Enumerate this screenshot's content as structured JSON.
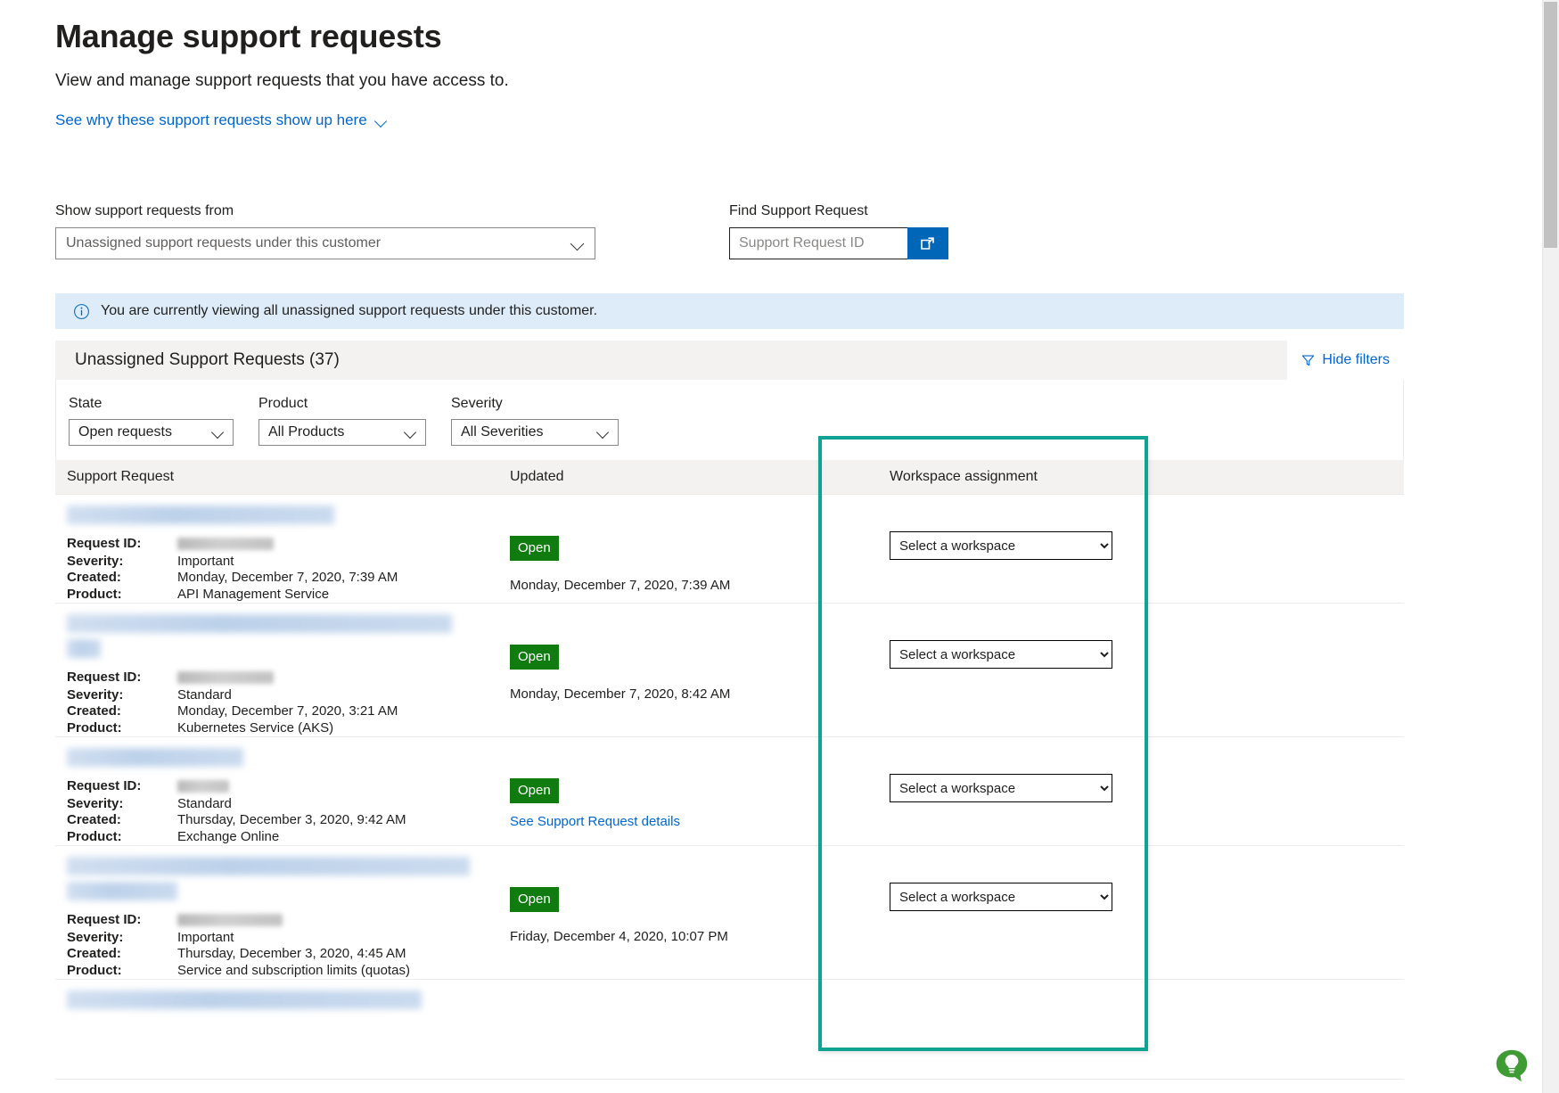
{
  "header": {
    "title": "Manage support requests",
    "subtitle": "View and manage support requests that you have access to.",
    "why_link": "See why these support requests show up here"
  },
  "top_filters": {
    "show_label": "Show support requests from",
    "show_value": "Unassigned support requests under this customer",
    "find_label": "Find Support Request",
    "find_placeholder": "Support Request ID",
    "find_value": "",
    "search_icon": "open-in-new-window-icon",
    "search_button_color": "#0067b8"
  },
  "info_banner": {
    "icon": "info-icon",
    "text": "You are currently viewing all unassigned support requests under this customer.",
    "background": "#deecf9"
  },
  "panel": {
    "title": "Unassigned Support Requests (37)",
    "hide_filters_label": "Hide filters",
    "hide_filters_icon": "funnel-icon",
    "filters": [
      {
        "label": "State",
        "value": "Open requests"
      },
      {
        "label": "Product",
        "value": "All Products"
      },
      {
        "label": "Severity",
        "value": "All Severities"
      }
    ],
    "columns": {
      "request": "Support Request",
      "updated": "Updated",
      "workspace": "Workspace assignment"
    },
    "labels": {
      "request_id": "Request ID:",
      "severity": "Severity:",
      "created": "Created:",
      "product": "Product:"
    },
    "workspace_placeholder": "Select a workspace",
    "workspace_options": [
      "Select a workspace"
    ],
    "rows": [
      {
        "title_redacted": true,
        "title_lines": [
          300
        ],
        "request_id_redacted": true,
        "request_id_width": 108,
        "severity": "Important",
        "created": "Monday, December 7, 2020, 7:39 AM",
        "product": "API Management Service",
        "state_badge": "Open",
        "updated": "Monday, December 7, 2020, 7:39 AM",
        "updated_link": "",
        "workspace": "Select a workspace"
      },
      {
        "title_redacted": true,
        "title_lines": [
          432,
          38
        ],
        "request_id_redacted": true,
        "request_id_width": 108,
        "severity": "Standard",
        "created": "Monday, December 7, 2020, 3:21 AM",
        "product": "Kubernetes Service (AKS)",
        "state_badge": "Open",
        "updated": "Monday, December 7, 2020, 8:42 AM",
        "updated_link": "",
        "workspace": "Select a workspace"
      },
      {
        "title_redacted": true,
        "title_lines": [
          198
        ],
        "request_id_redacted": true,
        "request_id_width": 58,
        "severity": "Standard",
        "created": "Thursday, December 3, 2020, 9:42 AM",
        "product": "Exchange Online",
        "state_badge": "Open",
        "updated": "",
        "updated_link": "See Support Request details",
        "workspace": "Select a workspace"
      },
      {
        "title_redacted": true,
        "title_lines": [
          452,
          124
        ],
        "request_id_redacted": true,
        "request_id_width": 118,
        "severity": "Important",
        "created": "Thursday, December 3, 2020, 4:45 AM",
        "product": "Service and subscription limits (quotas)",
        "state_badge": "Open",
        "updated": "Friday, December 4, 2020, 10:07 PM",
        "updated_link": "",
        "workspace": "Select a workspace"
      },
      {
        "title_redacted": true,
        "title_lines": [
          398
        ],
        "request_id_redacted": false,
        "request_id_width": 0,
        "severity": "",
        "created": "",
        "product": "",
        "state_badge": "",
        "updated": "",
        "updated_link": "",
        "workspace": ""
      }
    ]
  },
  "highlight": {
    "color": "#10a292",
    "target": "workspace-assignment-column"
  },
  "feedback_widget": {
    "icon": "lightbulb-feedback-icon",
    "color": "#3f9c35"
  },
  "scrollbar": {
    "thumb_color": "#c1c1c1",
    "track_color": "#f1f1f1"
  }
}
